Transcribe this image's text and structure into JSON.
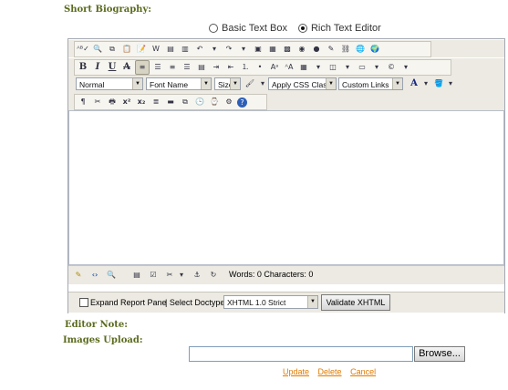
{
  "labels": {
    "short_bio": "Short Biography:",
    "editor_note": "Editor Note:",
    "images_upload": "Images Upload:"
  },
  "mode": {
    "basic": "Basic Text Box",
    "rich": "Rich Text Editor",
    "selected": "rich"
  },
  "toolbar": {
    "paragraph_format": "Normal",
    "font_name": "Font Name",
    "font_size": "Size",
    "css_class": "Apply CSS Class",
    "custom_links": "Custom Links"
  },
  "status": {
    "counts": "Words: 0 Characters: 0"
  },
  "doctype": {
    "expand_label": "Expand Report Pane",
    "select_label": "| Select Doctype:",
    "value": "XHTML 1.0 Strict",
    "validate": "Validate XHTML"
  },
  "upload": {
    "browse": "Browse..."
  },
  "actions": {
    "update": "Update",
    "delete": "Delete",
    "cancel": "Cancel"
  },
  "colors": {
    "label_green": "#5b6b1e",
    "link_orange": "#e07b00",
    "toolbar_bg": "#eceae2"
  }
}
